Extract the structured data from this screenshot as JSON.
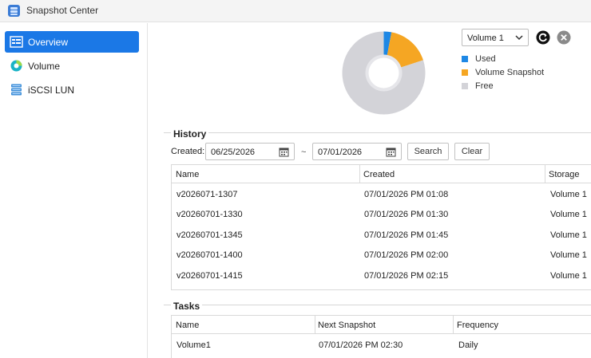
{
  "app": {
    "title": "Snapshot Center"
  },
  "sidebar": {
    "items": [
      {
        "label": "Overview",
        "icon": "overview-icon",
        "active": true
      },
      {
        "label": "Volume",
        "icon": "volume-icon",
        "active": false
      },
      {
        "label": "iSCSI LUN",
        "icon": "iscsi-lun-icon",
        "active": false
      }
    ]
  },
  "toolbar": {
    "volume_select": "Volume 1"
  },
  "usage_chart": {
    "legend": [
      {
        "label": "Used",
        "color": "#1e88e5"
      },
      {
        "label": "Volume Snapshot",
        "color": "#f5a623"
      },
      {
        "label": "Free",
        "color": "#d3d3d8"
      }
    ]
  },
  "chart_data": {
    "type": "pie",
    "categories": [
      "Used",
      "Volume Snapshot",
      "Free"
    ],
    "values": [
      3,
      17,
      80
    ],
    "colors": [
      "#1e88e5",
      "#f5a623",
      "#d3d3d8"
    ],
    "legend_position": "right"
  },
  "history": {
    "title": "History",
    "created_label": "Created:",
    "date_from": "06/25/2026",
    "date_separator": "~",
    "date_to": "07/01/2026",
    "search_label": "Search",
    "clear_label": "Clear",
    "columns": [
      "Name",
      "Created",
      "Storage"
    ],
    "rows": [
      [
        "v2026071-1307",
        "07/01/2026 PM 01:08",
        "Volume 1"
      ],
      [
        "v20260701-1330",
        "07/01/2026 PM 01:30",
        "Volume 1"
      ],
      [
        "v20260701-1345",
        "07/01/2026 PM 01:45",
        "Volume 1"
      ],
      [
        "v20260701-1400",
        "07/01/2026 PM 02:00",
        "Volume 1"
      ],
      [
        "v20260701-1415",
        "07/01/2026 PM 02:15",
        "Volume 1"
      ]
    ]
  },
  "tasks": {
    "title": "Tasks",
    "columns": [
      "Name",
      "Next Snapshot",
      "Frequency"
    ],
    "rows": [
      [
        "Volume1",
        "07/01/2026 PM 02:30",
        "Daily"
      ]
    ]
  }
}
